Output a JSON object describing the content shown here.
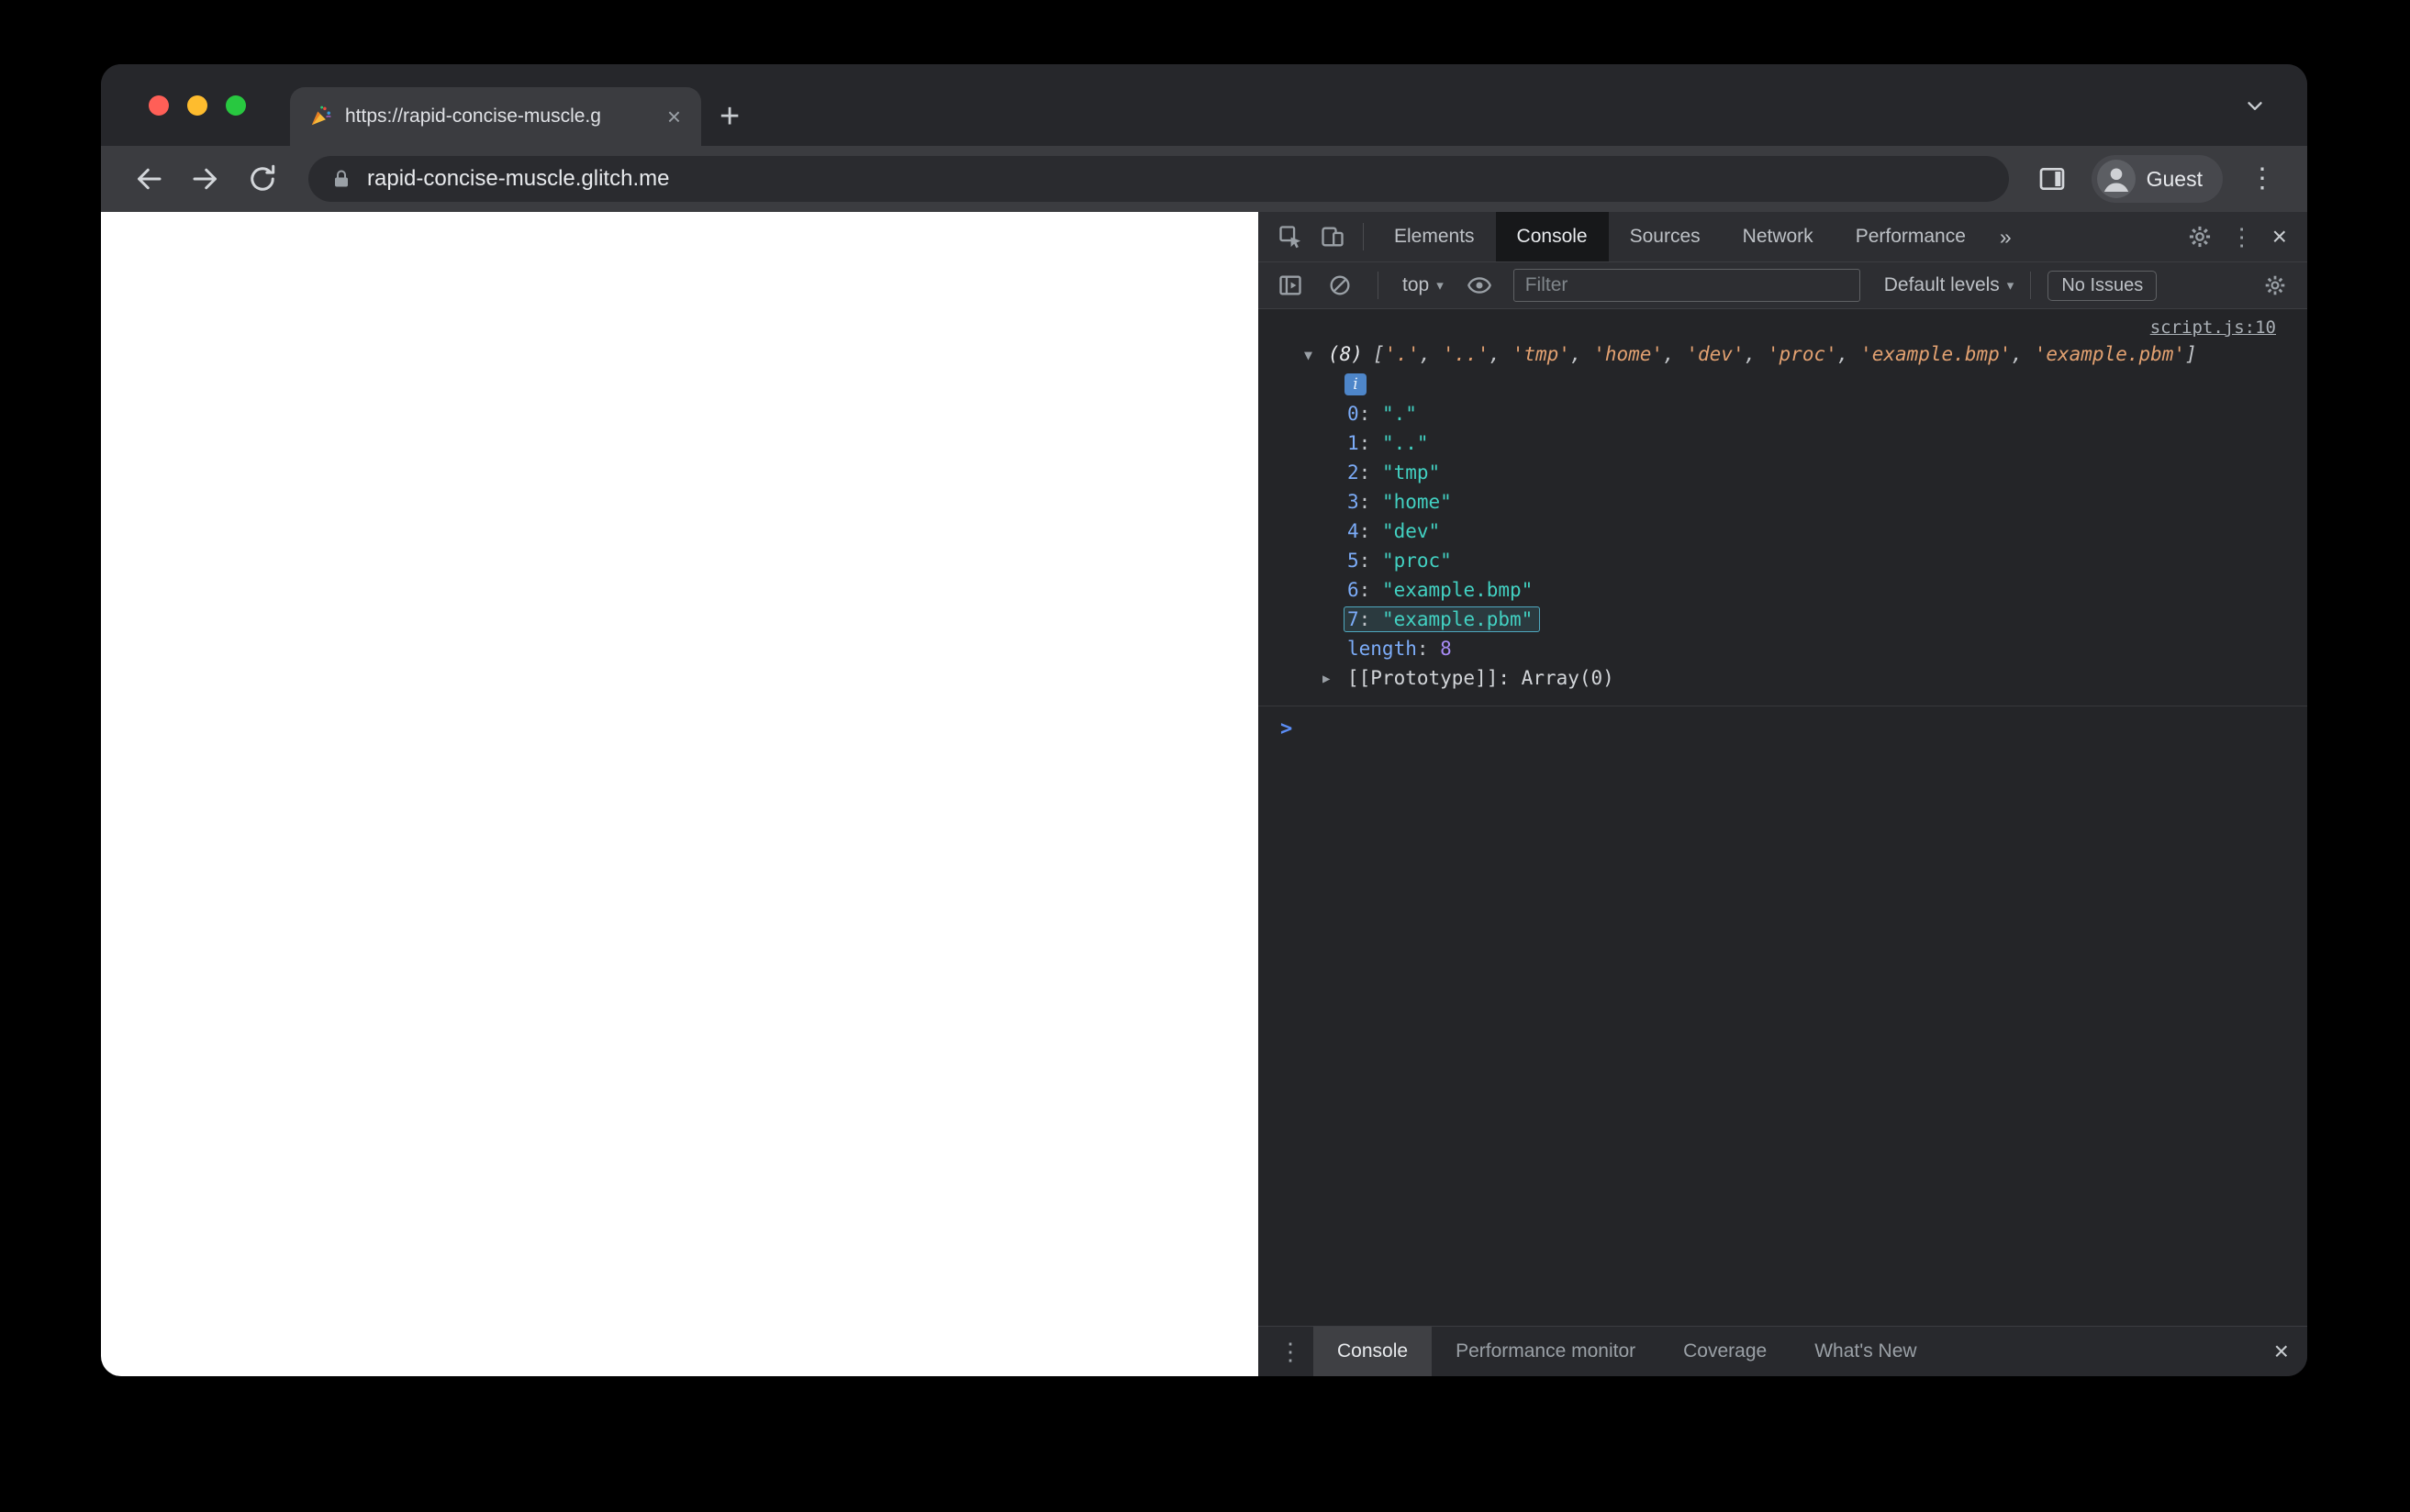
{
  "window": {
    "tab_title": "https://rapid-concise-muscle.g",
    "url": "rapid-concise-muscle.glitch.me",
    "guest_label": "Guest"
  },
  "icons": {
    "kebab": "⋮",
    "close": "×",
    "new_tab": "+",
    "more_tabs": "»",
    "dropdown": "▾",
    "disclosure_open": "▼",
    "disclosure_closed": "▶",
    "prompt": ">"
  },
  "colors": {
    "traffic_close": "#ff5f57",
    "traffic_minimize": "#febc2e",
    "traffic_zoom": "#28c840",
    "console_index_blue": "#7cacf8",
    "console_string_teal": "#42d1c2",
    "console_preview_orange": "#e2a171",
    "console_number_violet": "#a78bf5",
    "prompt_blue": "#5b8df5"
  },
  "devtools": {
    "panel_tabs": [
      {
        "label": "Elements",
        "selected": false
      },
      {
        "label": "Console",
        "selected": true
      },
      {
        "label": "Sources",
        "selected": false
      },
      {
        "label": "Network",
        "selected": false
      },
      {
        "label": "Performance",
        "selected": false
      }
    ],
    "context_selector": "top",
    "filter_placeholder": "Filter",
    "levels_label": "Default levels",
    "issues_label": "No Issues",
    "console": {
      "source_link": "script.js:10",
      "preview_count": "(8)",
      "bracket_open": "[",
      "bracket_close": "]",
      "preview_separator": ", ",
      "preview_items": [
        "'.'",
        "'..'",
        "'tmp'",
        "'home'",
        "'dev'",
        "'proc'",
        "'example.bmp'",
        "'example.pbm'"
      ],
      "info_badge": "i",
      "index_separator": ": ",
      "entries": [
        {
          "index": "0",
          "value": "\".\"",
          "highlighted": false
        },
        {
          "index": "1",
          "value": "\"..\"",
          "highlighted": false
        },
        {
          "index": "2",
          "value": "\"tmp\"",
          "highlighted": false
        },
        {
          "index": "3",
          "value": "\"home\"",
          "highlighted": false
        },
        {
          "index": "4",
          "value": "\"dev\"",
          "highlighted": false
        },
        {
          "index": "5",
          "value": "\"proc\"",
          "highlighted": false
        },
        {
          "index": "6",
          "value": "\"example.bmp\"",
          "highlighted": false
        },
        {
          "index": "7",
          "value": "\"example.pbm\"",
          "highlighted": true
        }
      ],
      "length_label": "length",
      "length_value": "8",
      "prototype_label": "[[Prototype]]",
      "prototype_separator": ": ",
      "prototype_value": "Array(0)"
    },
    "drawer_tabs": [
      {
        "label": "Console",
        "selected": true
      },
      {
        "label": "Performance monitor",
        "selected": false
      },
      {
        "label": "Coverage",
        "selected": false
      },
      {
        "label": "What's New",
        "selected": false
      }
    ]
  }
}
